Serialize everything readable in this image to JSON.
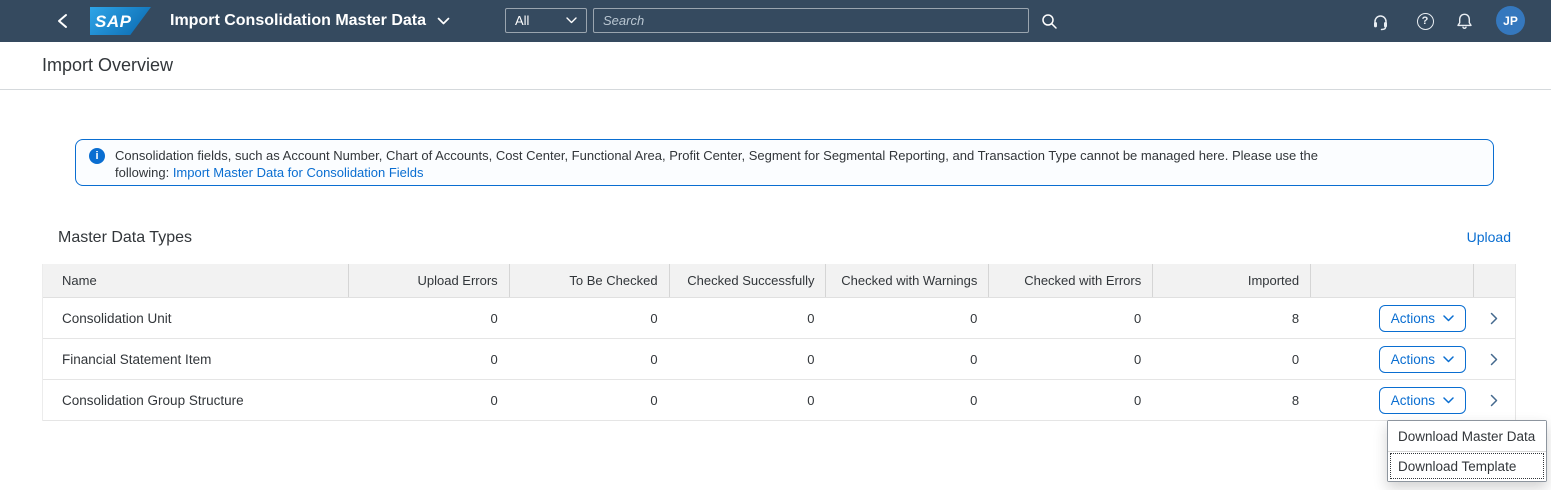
{
  "shell": {
    "logo_text": "SAP",
    "app_title": "Import Consolidation Master Data",
    "search_scope": "All",
    "search_placeholder": "Search",
    "help_glyph": "?",
    "avatar_initials": "JP",
    "icons": {
      "back": "chevron-left",
      "title_expand": "chevron-down",
      "search": "magnifier",
      "support": "headset",
      "help": "question-circle",
      "notifications": "bell"
    }
  },
  "page": {
    "title": "Import Overview"
  },
  "message_strip": {
    "info_glyph": "i",
    "line1": "Consolidation fields, such as Account Number, Chart of Accounts, Cost Center, Functional Area, Profit Center, Segment for Segmental Reporting, and Transaction Type cannot be managed here. Please use the",
    "line2_prefix": "following: ",
    "link_label": "Import Master Data for Consolidation Fields"
  },
  "section": {
    "title": "Master Data Types",
    "upload_label": "Upload"
  },
  "table": {
    "columns": [
      "Name",
      "Upload Errors",
      "To Be Checked",
      "Checked Successfully",
      "Checked with Warnings",
      "Checked with Errors",
      "Imported"
    ],
    "actions_label": "Actions",
    "rows": [
      {
        "name": "Consolidation Unit",
        "values": [
          "0",
          "0",
          "0",
          "0",
          "0",
          "8"
        ]
      },
      {
        "name": "Financial Statement Item",
        "values": [
          "0",
          "0",
          "0",
          "0",
          "0",
          "0"
        ]
      },
      {
        "name": "Consolidation Group Structure",
        "values": [
          "0",
          "0",
          "0",
          "0",
          "0",
          "8"
        ]
      }
    ]
  },
  "actions_menu": {
    "items": [
      "Download Master Data",
      "Download Template"
    ]
  },
  "colors": {
    "shell_bar": "#354a5f",
    "accent_blue": "#0a6ed1",
    "avatar_blue": "#3578be",
    "table_header_bg": "#f2f2f2",
    "text_dark": "#32363a"
  }
}
